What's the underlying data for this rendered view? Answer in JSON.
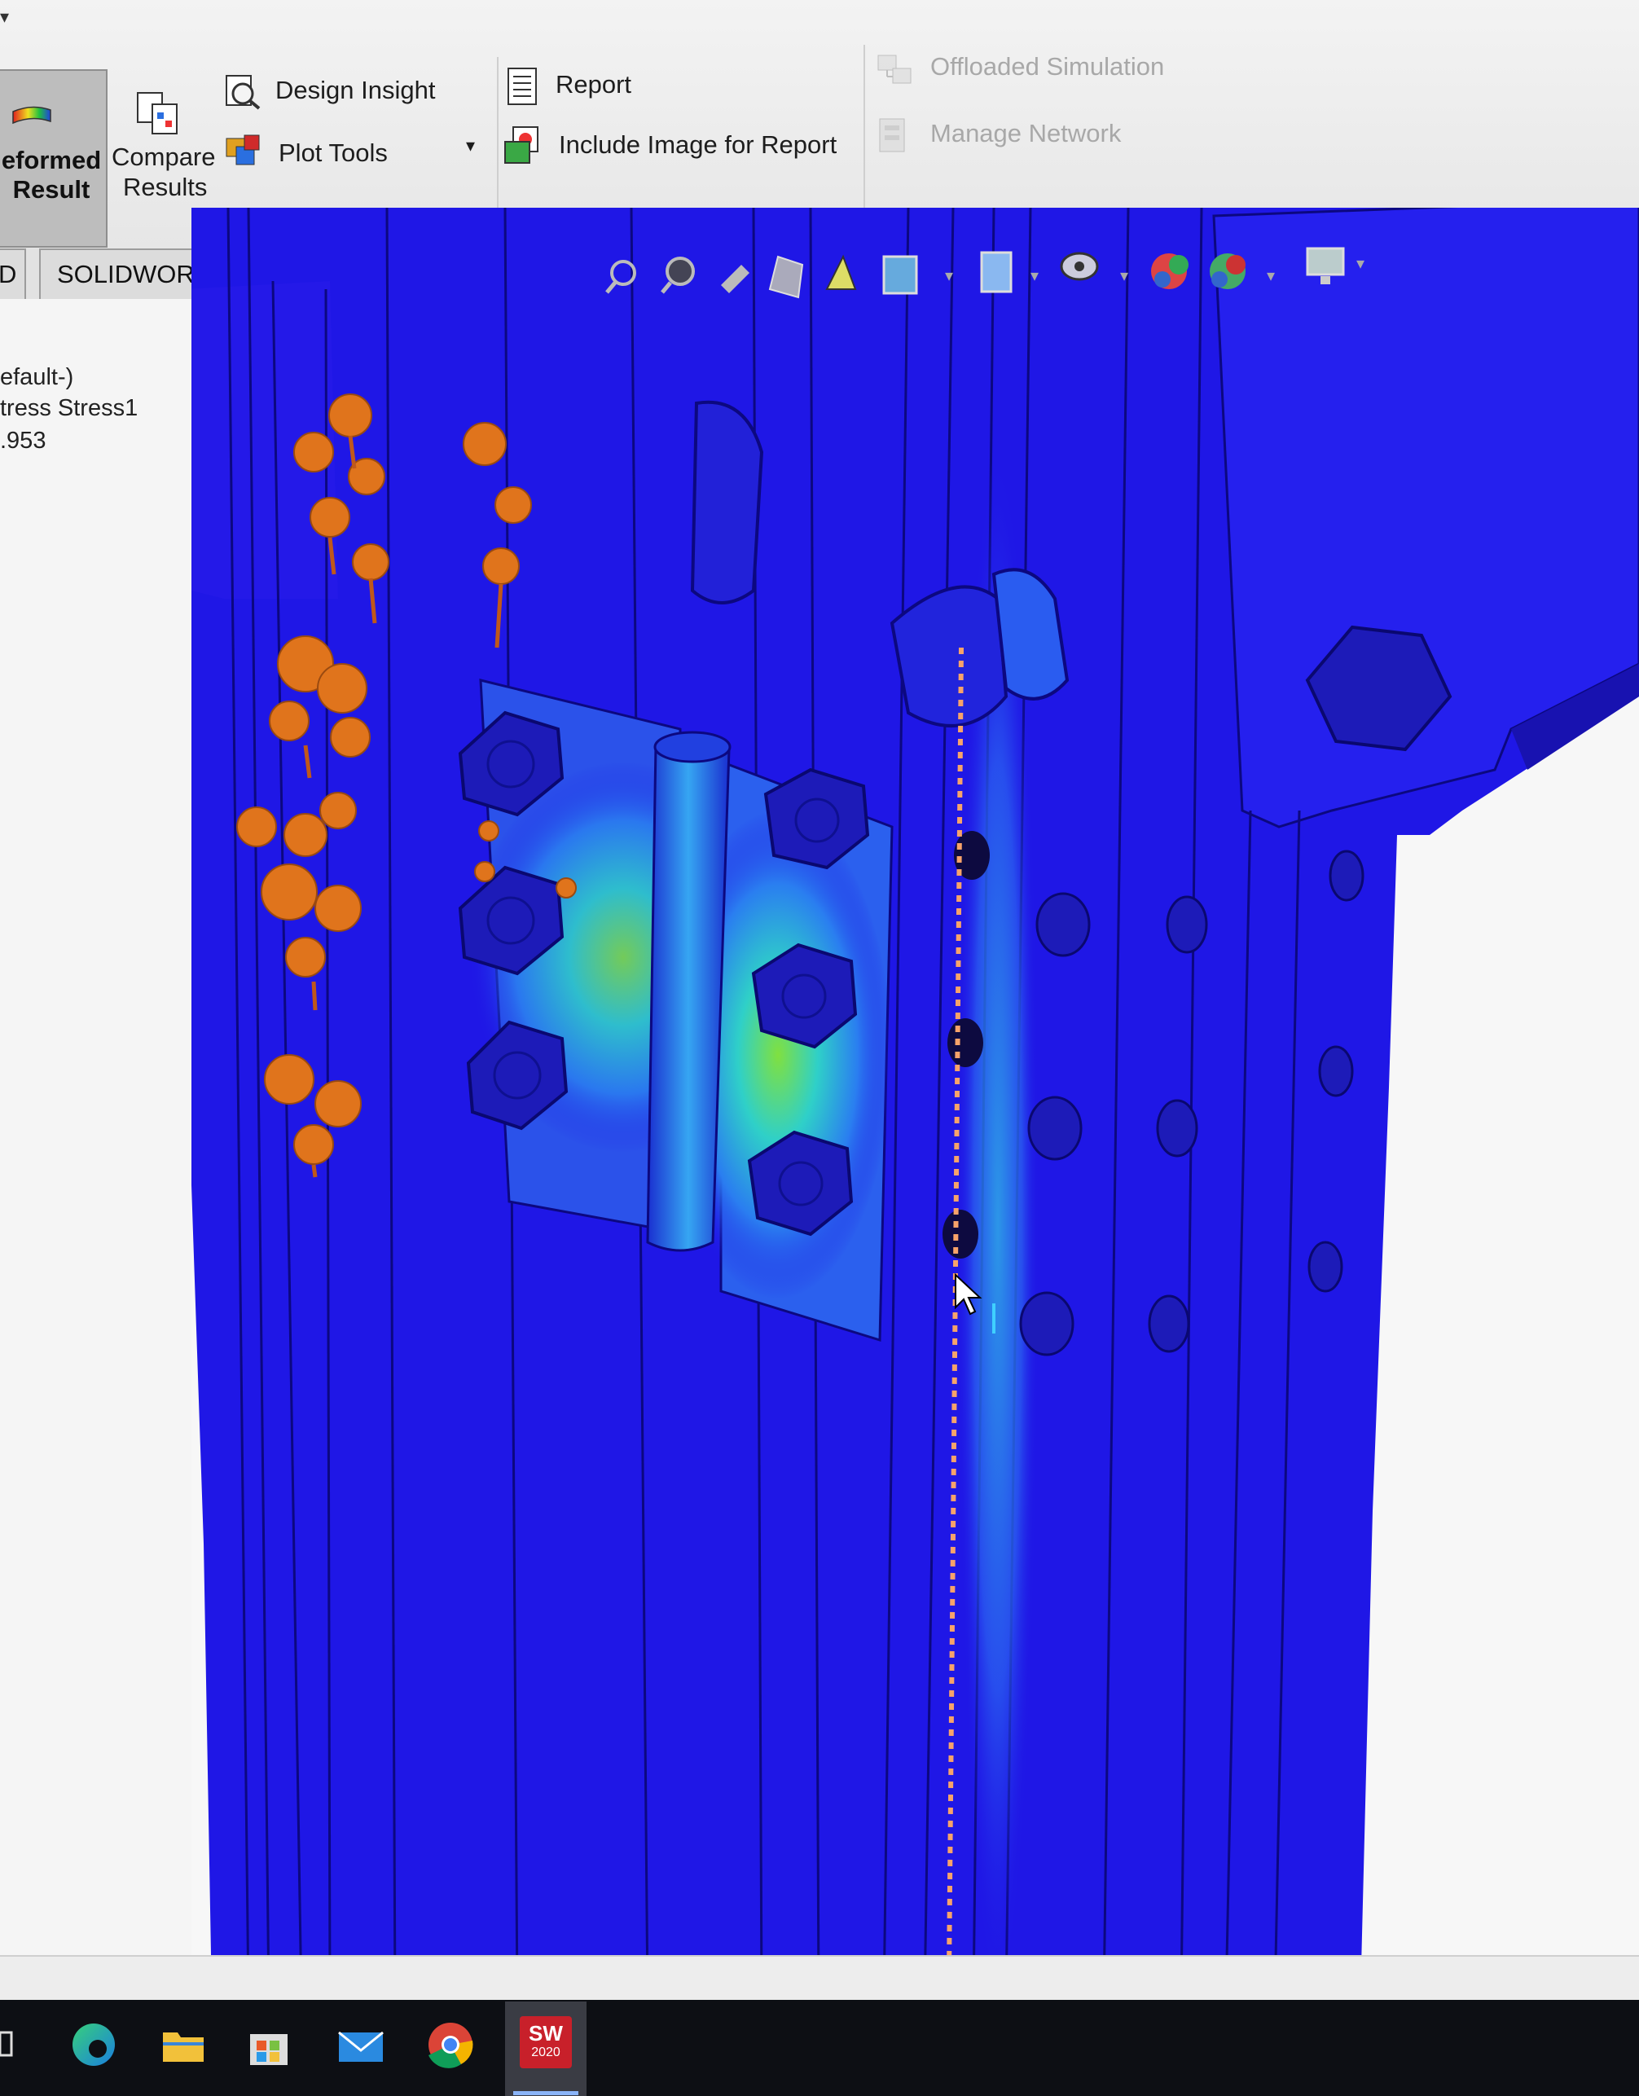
{
  "ribbon": {
    "deformed_result": {
      "line1": "eformed",
      "line2": "Result"
    },
    "compare_results": {
      "line1": "Compare",
      "line2": "Results"
    },
    "design_insight": "Design Insight",
    "plot_tools": "Plot Tools",
    "report": "Report",
    "include_image": "Include Image for Report",
    "offloaded_simulation": "Offloaded Simulation",
    "manage_network": "Manage Network"
  },
  "tabs": {
    "prev_tab_fragment": "D",
    "solidworks_cam": "SOLIDWORKS CAM"
  },
  "tree": {
    "line1": "efault-)",
    "line2": "tress Stress1",
    "line3": ".953"
  },
  "taskbar": {
    "solidworks_year": "2020",
    "solidworks_short": "SW"
  },
  "colors": {
    "model_blue": "#1f17e6",
    "stress_cyan": "#2fb8e8",
    "stress_green": "#7fe03a",
    "fixture_orange": "#e0741c",
    "probe_line": "#f7a36a"
  },
  "icons": [
    "zoom-to-fit-icon",
    "zoom-to-area-icon",
    "previous-view-icon",
    "section-view-icon",
    "view-selector-icon",
    "display-style-icon",
    "hide-show-items-icon",
    "edit-appearance-icon",
    "apply-scene-icon",
    "view-settings-icon",
    "monitor-icon"
  ]
}
